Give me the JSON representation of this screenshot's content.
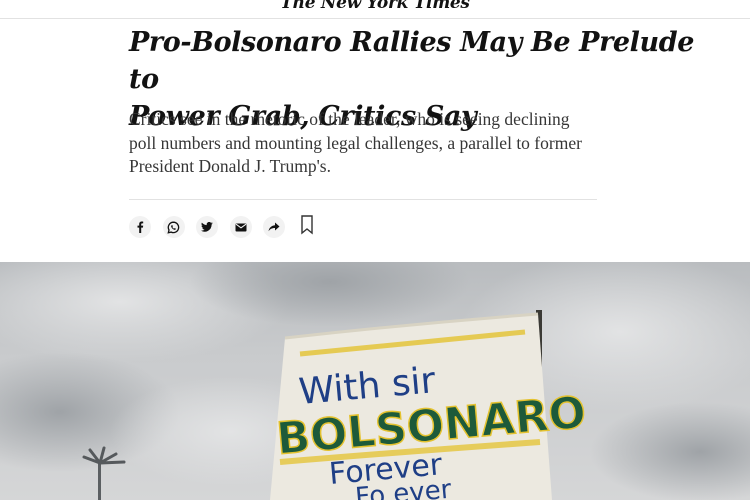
{
  "header": {
    "masthead": "The New York Times"
  },
  "article": {
    "headline_line1": "Pro-Bolsonaro Rallies May Be Prelude to",
    "headline_line2": "Power Grab, Critics Say",
    "summary_line1": "Critics see in the rhetoric of the leader, who is seeing declining",
    "summary_line2": "poll numbers and mounting legal challenges, a parallel to former",
    "summary_line3": "President Donald J. Trump's."
  },
  "share": {
    "icons": [
      "facebook-icon",
      "whatsapp-icon",
      "twitter-icon",
      "email-icon",
      "share-arrow-icon",
      "bookmark-icon"
    ]
  },
  "photo": {
    "sign_line1": "With sir",
    "sign_line2": "BOLSONARO",
    "sign_line3": "Forever",
    "sign_line4": "Fo ever",
    "colors": {
      "sky": "#c4c6c8",
      "sign": "#ece9e0",
      "ink_blue": "#1f3f86",
      "ink_green": "#1d5a3a",
      "ink_yellow": "#e4c22f"
    }
  }
}
